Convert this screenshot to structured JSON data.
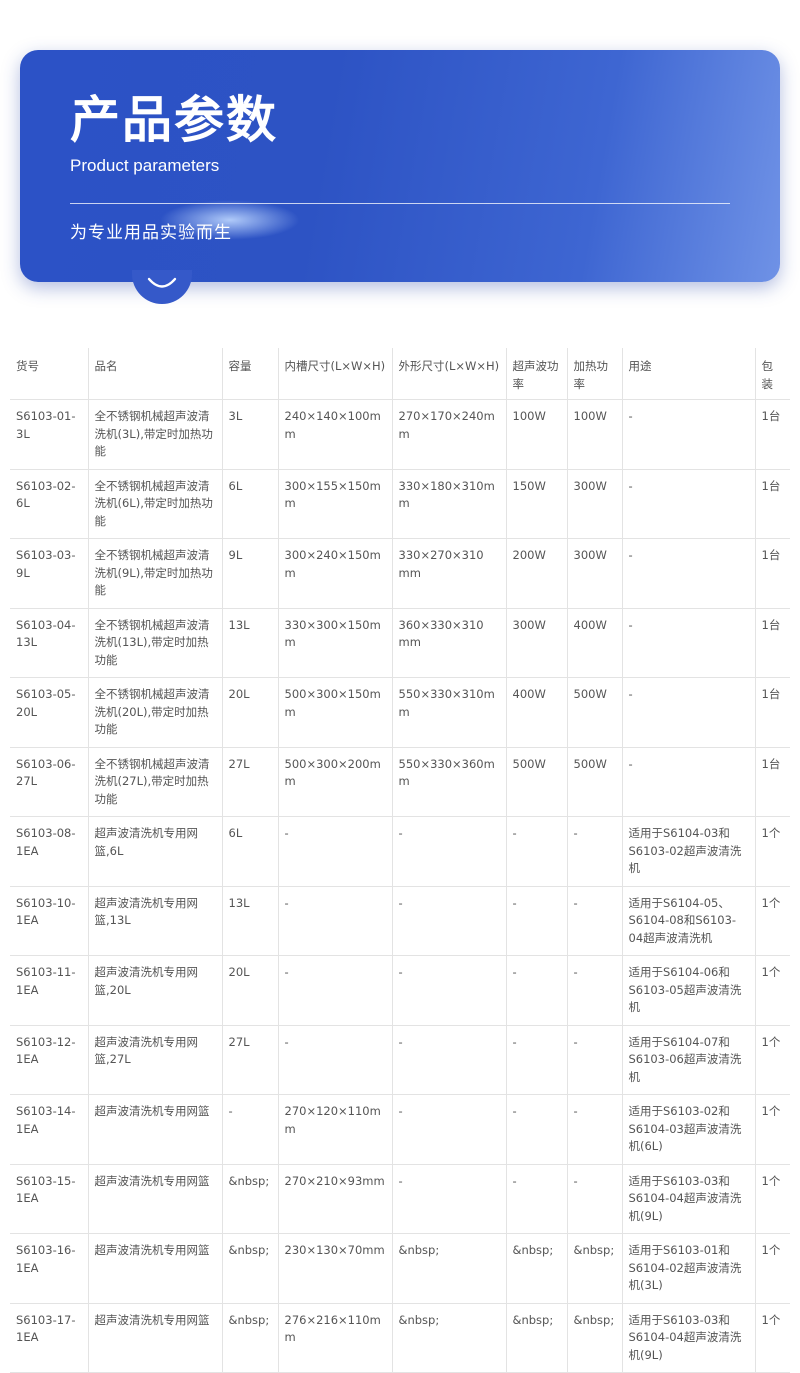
{
  "banner": {
    "title": "产品参数",
    "subtitle": "Product parameters",
    "slogan": "为专业用品实验而生"
  },
  "table": {
    "headers": [
      "货号",
      "品名",
      "容量",
      "内槽尺寸(L×W×H)",
      "外形尺寸(L×W×H)",
      "超声波功率",
      "加热功率",
      "用途",
      "包装"
    ],
    "rows": [
      [
        "S6103-01-3L",
        "全不锈钢机械超声波清洗机(3L),带定时加热功能",
        "3L",
        "240×140×100mm",
        "270×170×240mm",
        "100W",
        "100W",
        "-",
        "1台"
      ],
      [
        "S6103-02-6L",
        "全不锈钢机械超声波清洗机(6L),带定时加热功能",
        "6L",
        "300×155×150mm",
        "330×180×310mm",
        "150W",
        "300W",
        "-",
        "1台"
      ],
      [
        "S6103-03-9L",
        "全不锈钢机械超声波清洗机(9L),带定时加热功能",
        "9L",
        "300×240×150mm",
        "330×270×310 mm",
        "200W",
        "300W",
        "-",
        "1台"
      ],
      [
        "S6103-04-13L",
        "全不锈钢机械超声波清洗机(13L),带定时加热功能",
        "13L",
        "330×300×150mm",
        "360×330×310 mm",
        "300W",
        "400W",
        "-",
        "1台"
      ],
      [
        "S6103-05-20L",
        "全不锈钢机械超声波清洗机(20L),带定时加热功能",
        "20L",
        "500×300×150mm",
        "550×330×310mm",
        "400W",
        "500W",
        "-",
        "1台"
      ],
      [
        "S6103-06-27L",
        "全不锈钢机械超声波清洗机(27L),带定时加热功能",
        "27L",
        "500×300×200mm",
        "550×330×360mm",
        "500W",
        "500W",
        "-",
        "1台"
      ],
      [
        "S6103-08-1EA",
        "超声波清洗机专用网篮,6L",
        "6L",
        "-",
        "-",
        "-",
        "-",
        "适用于S6104-03和S6103-02超声波清洗机",
        "1个"
      ],
      [
        "S6103-10-1EA",
        "超声波清洗机专用网篮,13L",
        "13L",
        "-",
        "-",
        "-",
        "-",
        "适用于S6104-05、S6104-08和S6103-04超声波清洗机",
        "1个"
      ],
      [
        "S6103-11-1EA",
        "超声波清洗机专用网篮,20L",
        "20L",
        "-",
        "-",
        "-",
        "-",
        "适用于S6104-06和S6103-05超声波清洗机",
        "1个"
      ],
      [
        "S6103-12-1EA",
        "超声波清洗机专用网篮,27L",
        "27L",
        "-",
        "-",
        "-",
        "-",
        "适用于S6104-07和S6103-06超声波清洗机",
        "1个"
      ],
      [
        "S6103-14-1EA",
        "超声波清洗机专用网篮",
        "-",
        "270×120×110mm",
        "-",
        "-",
        "-",
        "适用于S6103-02和S6104-03超声波清洗机(6L)",
        "1个"
      ],
      [
        "S6103-15-1EA",
        "超声波清洗机专用网篮",
        "&nbsp;",
        "270×210×93mm",
        "-",
        "-",
        "-",
        "适用于S6103-03和S6104-04超声波清洗机(9L)",
        "1个"
      ],
      [
        "S6103-16-1EA",
        "超声波清洗机专用网篮",
        "&nbsp;",
        "230×130×70mm",
        "&nbsp;",
        "&nbsp;",
        "&nbsp;",
        "适用于S6103-01和S6104-02超声波清洗机(3L)",
        "1个"
      ],
      [
        "S6103-17-1EA",
        "超声波清洗机专用网篮",
        "&nbsp;",
        "276×216×110mm",
        "&nbsp;",
        "&nbsp;",
        "&nbsp;",
        "适用于S6103-03和S6104-04超声波清洗机(9L)",
        "1个"
      ]
    ]
  }
}
